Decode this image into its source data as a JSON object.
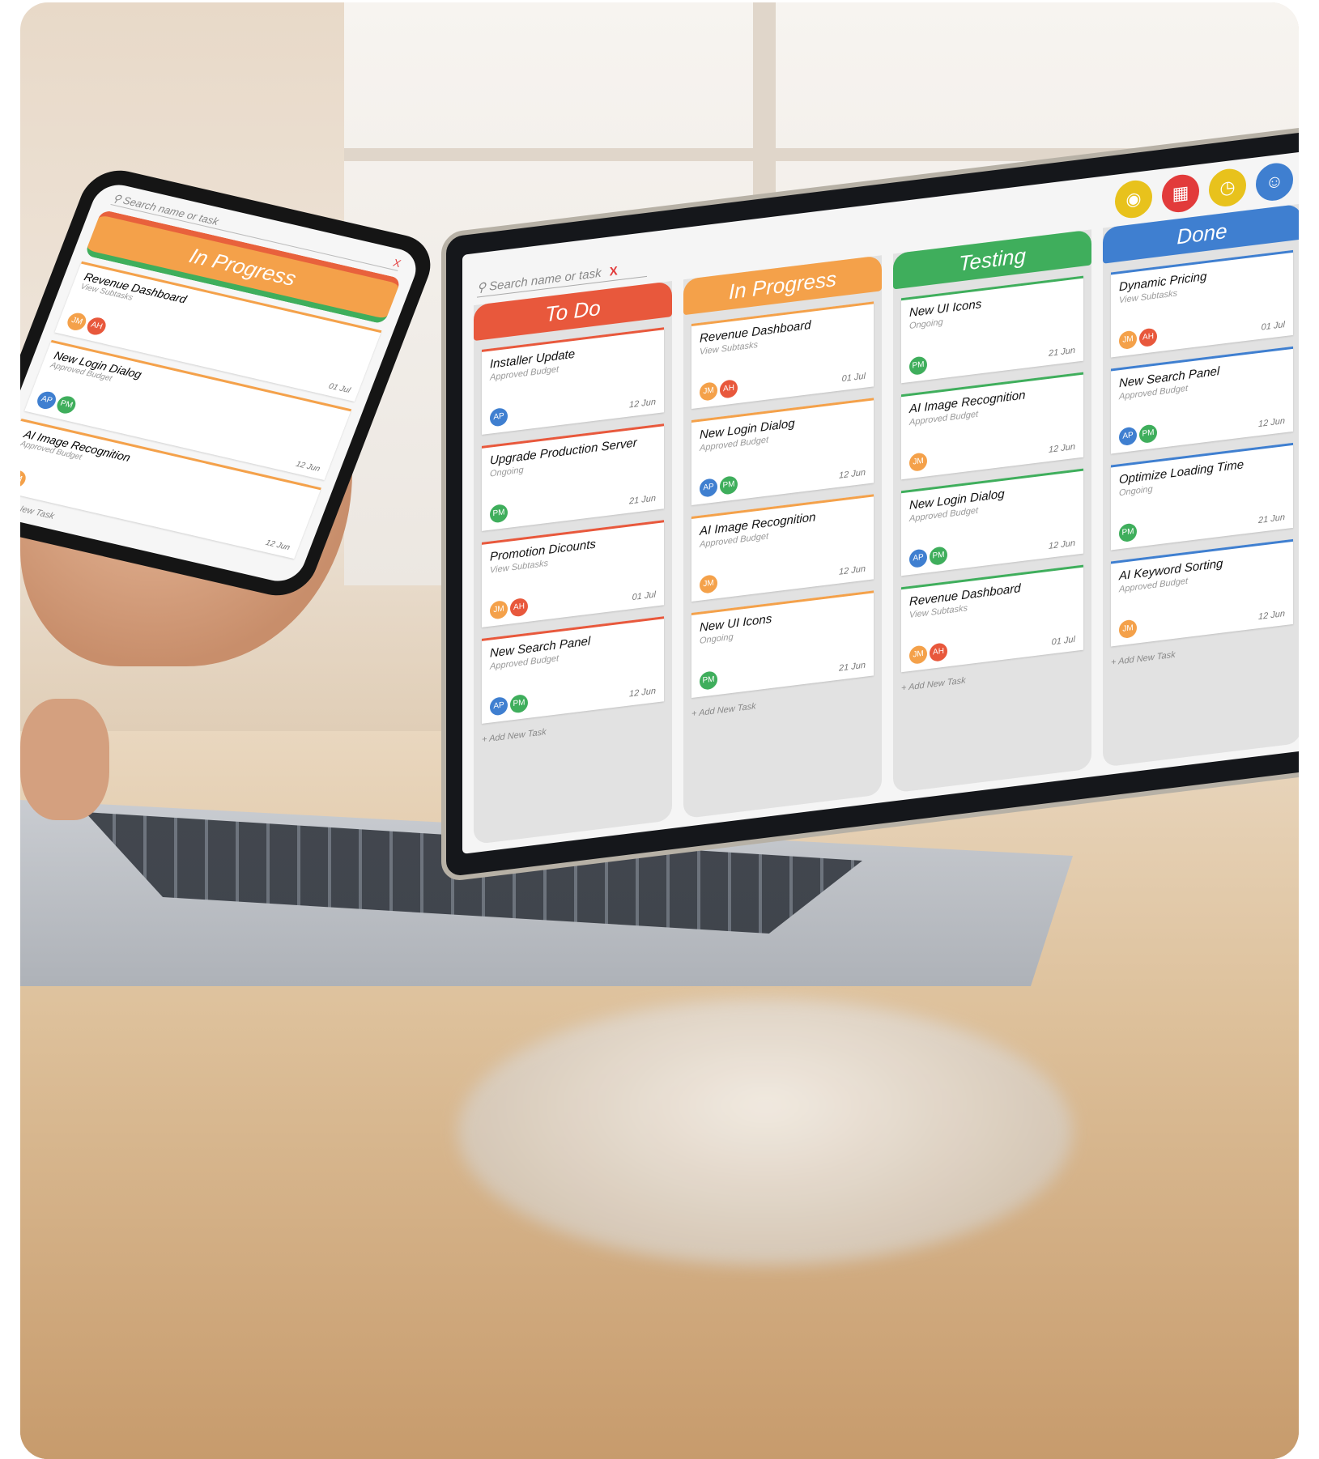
{
  "laptop": {
    "search_placeholder": "Search name or task",
    "search_clear": "X",
    "top_icons": [
      {
        "name": "lightbulb-icon",
        "color": "#e8c21c"
      },
      {
        "name": "calendar-icon",
        "color": "#e23b3b"
      },
      {
        "name": "clock-icon",
        "color": "#e8c21c"
      },
      {
        "name": "user-icon",
        "color": "#3f7fd0"
      }
    ],
    "columns": [
      {
        "title": "To Do",
        "color": "#e8583c",
        "add": "+ Add New Task",
        "cards": [
          {
            "title": "Installer Update",
            "sub": "Approved Budget",
            "date": "12 Jun",
            "avatars": [
              "AP"
            ]
          },
          {
            "title": "Upgrade Production Server",
            "sub": "Ongoing",
            "date": "21 Jun",
            "avatars": [
              "PM"
            ]
          },
          {
            "title": "Promotion Dicounts",
            "sub": "View Subtasks",
            "date": "01 Jul",
            "avatars": [
              "JM",
              "AH"
            ]
          },
          {
            "title": "New Search Panel",
            "sub": "Approved Budget",
            "date": "12 Jun",
            "avatars": [
              "AP",
              "PM"
            ]
          }
        ]
      },
      {
        "title": "In Progress",
        "color": "#f4a14a",
        "add": "+ Add New Task",
        "cards": [
          {
            "title": "Revenue Dashboard",
            "sub": "View Subtasks",
            "date": "01 Jul",
            "avatars": [
              "JM",
              "AH"
            ]
          },
          {
            "title": "New Login Dialog",
            "sub": "Approved Budget",
            "date": "12 Jun",
            "avatars": [
              "AP",
              "PM"
            ]
          },
          {
            "title": "AI Image Recognition",
            "sub": "Approved Budget",
            "date": "12 Jun",
            "avatars": [
              "JM"
            ]
          },
          {
            "title": "New UI Icons",
            "sub": "Ongoing",
            "date": "21 Jun",
            "avatars": [
              "PM"
            ]
          }
        ]
      },
      {
        "title": "Testing",
        "color": "#3fae5c",
        "add": "+ Add New Task",
        "cards": [
          {
            "title": "New UI Icons",
            "sub": "Ongoing",
            "date": "21 Jun",
            "avatars": [
              "PM"
            ]
          },
          {
            "title": "AI Image Recognition",
            "sub": "Approved Budget",
            "date": "12 Jun",
            "avatars": [
              "JM"
            ]
          },
          {
            "title": "New Login Dialog",
            "sub": "Approved Budget",
            "date": "12 Jun",
            "avatars": [
              "AP",
              "PM"
            ]
          },
          {
            "title": "Revenue Dashboard",
            "sub": "View Subtasks",
            "date": "01 Jul",
            "avatars": [
              "JM",
              "AH"
            ]
          }
        ]
      },
      {
        "title": "Done",
        "color": "#3f7fd0",
        "add": "+ Add New Task",
        "cards": [
          {
            "title": "Dynamic Pricing",
            "sub": "View Subtasks",
            "date": "01 Jul",
            "avatars": [
              "JM",
              "AH"
            ]
          },
          {
            "title": "New Search Panel",
            "sub": "Approved Budget",
            "date": "12 Jun",
            "avatars": [
              "AP",
              "PM"
            ]
          },
          {
            "title": "Optimize Loading Time",
            "sub": "Ongoing",
            "date": "21 Jun",
            "avatars": [
              "PM"
            ]
          },
          {
            "title": "AI Keyword Sorting",
            "sub": "Approved Budget",
            "date": "12 Jun",
            "avatars": [
              "JM"
            ]
          }
        ]
      }
    ]
  },
  "phone": {
    "search_placeholder": "Search name or task",
    "search_clear": "X",
    "column_title": "In Progress",
    "add": "+ Add New Task",
    "cards": [
      {
        "title": "Revenue Dashboard",
        "sub": "View Subtasks",
        "date": "01 Jul",
        "avatars": [
          "JM",
          "AH"
        ]
      },
      {
        "title": "New Login Dialog",
        "sub": "Approved Budget",
        "date": "12 Jun",
        "avatars": [
          "AP",
          "PM"
        ]
      },
      {
        "title": "AI Image Recognition",
        "sub": "Approved Budget",
        "date": "12 Jun",
        "avatars": [
          "JM"
        ]
      }
    ]
  },
  "avatar_colors": {
    "JM": "#f4a14a",
    "AH": "#e8583c",
    "AP": "#3f7fd0",
    "PM": "#3fae5c"
  }
}
